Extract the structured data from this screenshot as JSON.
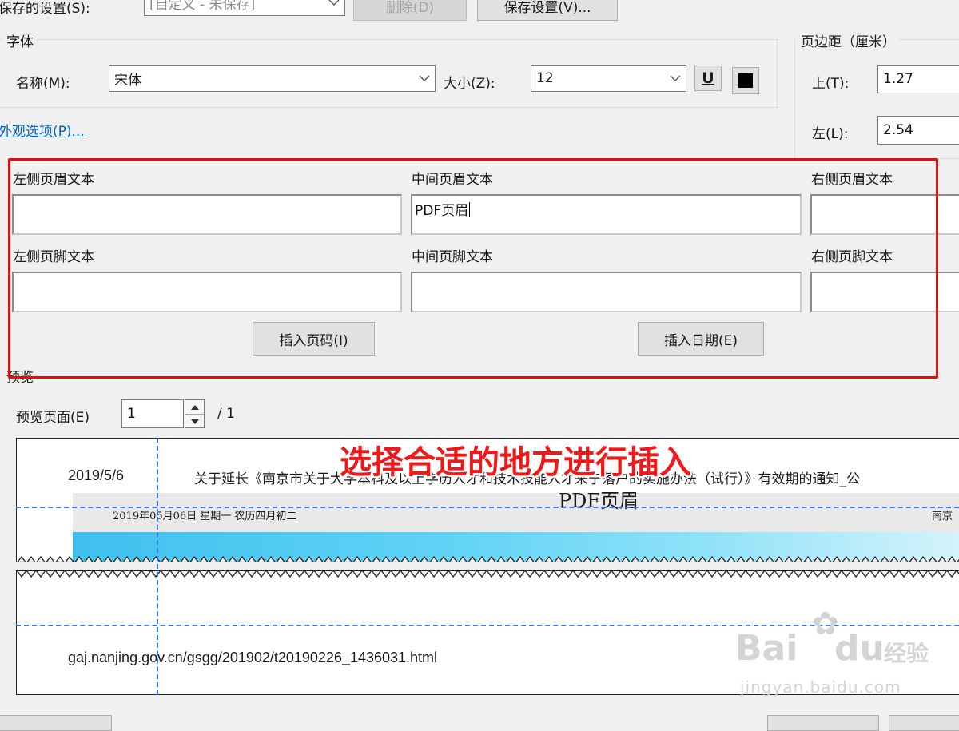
{
  "top_row": {
    "saved_settings_label": "保存的设置(S):",
    "saved_settings_value": "[自定义 - 未保存]",
    "delete_label": "删除(D)",
    "save_settings_label": "保存设置(V)..."
  },
  "font_group": {
    "title": "字体",
    "name_label": "名称(M):",
    "name_value": "宋体",
    "size_label": "大小(Z):",
    "size_value": "12",
    "underline_glyph": "U"
  },
  "margins": {
    "title": "页边距（厘米）",
    "top_label": "上(T):",
    "top_value": "1.27",
    "left_label": "左(L):",
    "left_value": "2.54"
  },
  "appearance_link": "外观选项(P)...",
  "header_footer": {
    "left_header_label": "左侧页眉文本",
    "center_header_label": "中间页眉文本",
    "right_header_label": "右侧页眉文本",
    "left_header_value": "",
    "center_header_value": "PDF页眉",
    "right_header_value": "",
    "left_footer_label": "左侧页脚文本",
    "center_footer_label": "中间页脚文本",
    "right_footer_label": "右侧页脚文本",
    "insert_page_number": "插入页码(I)",
    "insert_date": "插入日期(E)"
  },
  "preview": {
    "title": "预览",
    "page_label": "预览页面(E)",
    "page_value": "1",
    "page_total": "/ 1",
    "date_text": "2019/5/6",
    "doc_title": "关于延长《南京市关于大学本科及以上学历人才和技术技能人才来宁落户的实施办法（试行）》有效期的通知_公",
    "header_text": "PDF页眉",
    "page_date_line": "2019年05月06日  星期一      农历四月初二",
    "page_right_text": "南京",
    "footer_url": "gaj.nanjing.gov.cn/gsgg/201902/t20190226_1436031.html"
  },
  "annotation": "选择合适的地方进行插入",
  "watermark": {
    "brand": "Bai",
    "brand_suffix": "du",
    "brand_cn": "经验",
    "url": "jingyan.baidu.com"
  },
  "colors": {
    "annotation_red": "#f01818",
    "guide_blue": "#3a78e6",
    "link_blue": "#0066cc"
  }
}
